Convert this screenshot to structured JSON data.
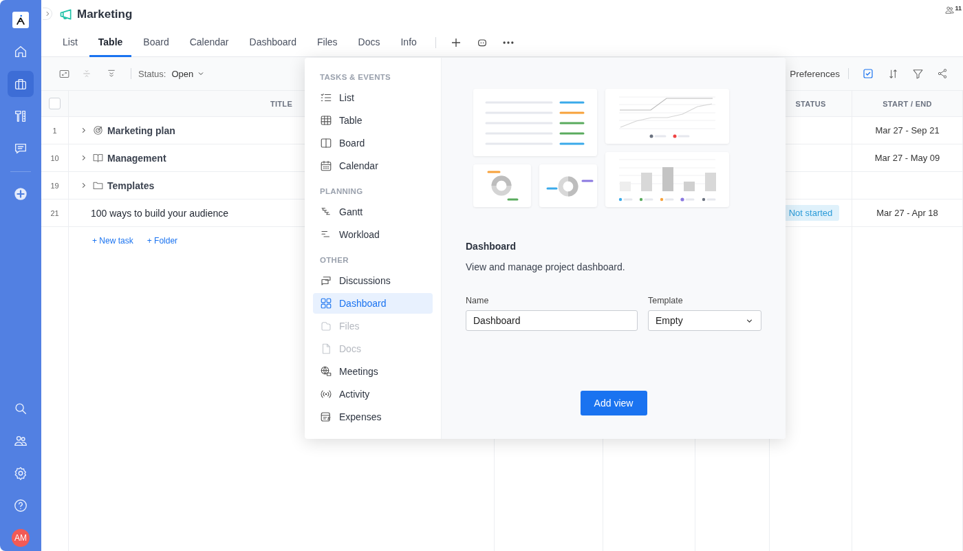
{
  "sidebar": {
    "top_items": [
      {
        "kind": "home",
        "selected": false
      },
      {
        "kind": "briefcase",
        "selected": true
      },
      {
        "kind": "tools",
        "selected": false
      },
      {
        "kind": "chat",
        "selected": false
      }
    ],
    "bottom_items": [
      {
        "kind": "search",
        "selected": false
      },
      {
        "kind": "people",
        "selected": false
      },
      {
        "kind": "settings",
        "selected": false
      },
      {
        "kind": "help",
        "selected": false
      }
    ],
    "avatar": "AM"
  },
  "header": {
    "title": "Marketing",
    "members_count": "11"
  },
  "tabs": [
    {
      "label": "List",
      "selected": false
    },
    {
      "label": "Table",
      "selected": true
    },
    {
      "label": "Board",
      "selected": false
    },
    {
      "label": "Calendar",
      "selected": false
    },
    {
      "label": "Dashboard",
      "selected": false
    },
    {
      "label": "Files",
      "selected": false
    },
    {
      "label": "Docs",
      "selected": false
    },
    {
      "label": "Info",
      "selected": false
    }
  ],
  "toolbar": {
    "status_label": "Status:",
    "status_value": "Open",
    "preferences": "Preferences",
    "show_completed": true
  },
  "table": {
    "select_all_checked": false,
    "columns": [
      {
        "label": "TITLE"
      },
      {
        "label": "STATUS"
      },
      {
        "label": "START / END"
      }
    ],
    "rows": [
      {
        "number": "1",
        "kind": "target",
        "title": "Marketing plan",
        "dates": "Mar 27 - Sep 21"
      },
      {
        "number": "10",
        "kind": "book",
        "title": "Management",
        "dates": "Mar 27 - May 09"
      },
      {
        "number": "19",
        "kind": "folder",
        "title": "Templates"
      },
      {
        "number": "21",
        "kind": "task",
        "title": "100 ways to build your audience",
        "status": "Not started",
        "dates": "Mar 27 - Apr 18"
      }
    ],
    "add_links": [
      "+ New task",
      "+ Folder"
    ]
  },
  "popup": {
    "sections": [
      {
        "title": "TASKS & EVENTS",
        "items": [
          {
            "label": "List",
            "kind": "list",
            "selected": false,
            "disabled": false
          },
          {
            "label": "Table",
            "kind": "table",
            "selected": false,
            "disabled": false
          },
          {
            "label": "Board",
            "kind": "board",
            "selected": false,
            "disabled": false
          },
          {
            "label": "Calendar",
            "kind": "calendar",
            "selected": false,
            "disabled": false
          }
        ]
      },
      {
        "title": "PLANNING",
        "items": [
          {
            "label": "Gantt",
            "kind": "gantt",
            "selected": false,
            "disabled": false
          },
          {
            "label": "Workload",
            "kind": "workload",
            "selected": false,
            "disabled": false
          }
        ]
      },
      {
        "title": "OTHER",
        "items": [
          {
            "label": "Discussions",
            "kind": "discussions",
            "selected": false,
            "disabled": false
          },
          {
            "label": "Dashboard",
            "kind": "dashboard",
            "selected": true,
            "disabled": false
          },
          {
            "label": "Files",
            "kind": "files",
            "selected": false,
            "disabled": true
          },
          {
            "label": "Docs",
            "kind": "docs",
            "selected": false,
            "disabled": true
          },
          {
            "label": "Meetings",
            "kind": "meetings",
            "selected": false,
            "disabled": false
          },
          {
            "label": "Activity",
            "kind": "activity",
            "selected": false,
            "disabled": false
          },
          {
            "label": "Expenses",
            "kind": "expenses",
            "selected": false,
            "disabled": false
          }
        ]
      }
    ],
    "detail": {
      "title": "Dashboard",
      "description": "View and manage project dashboard.",
      "name_label": "Name",
      "name_value": "Dashboard",
      "template_label": "Template",
      "template_value": "Empty",
      "button": "Add view"
    }
  }
}
